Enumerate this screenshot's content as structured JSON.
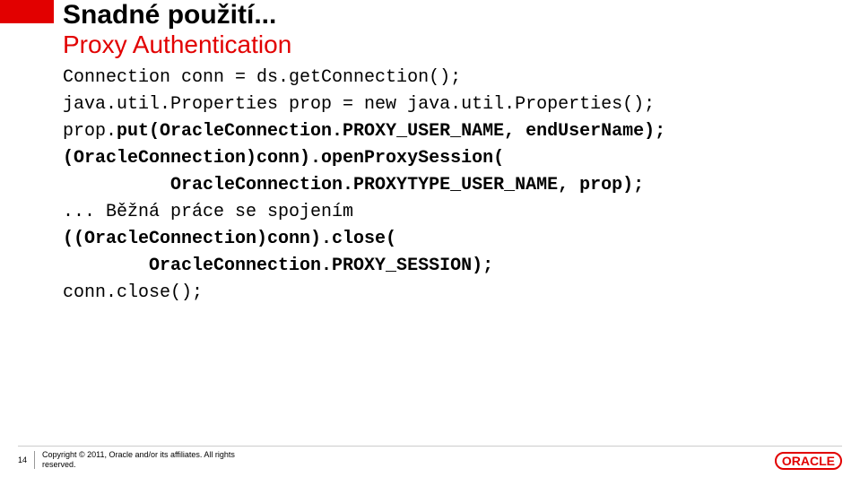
{
  "slide": {
    "title_main": "Snadné použití...",
    "title_sub": "Proxy Authentication",
    "code": {
      "line1": "Connection conn = ds.getConnection();",
      "line2": "",
      "line3": "java.util.Properties prop = new java.util.Properties();",
      "line4a": "prop.",
      "line4b": "put(OracleConnection.PROXY_USER_NAME, endUserName);",
      "line5": "(OracleConnection)conn).openProxySession(",
      "line6": "          OracleConnection.PROXYTYPE_USER_NAME, prop);",
      "line7": "",
      "line8": "... Běžná práce se spojením",
      "line9": "",
      "line10": "((OracleConnection)conn).close(",
      "line11": "        OracleConnection.PROXY_SESSION);",
      "line12": "conn.close();"
    }
  },
  "footer": {
    "page_num": "14",
    "copyright_line1": "Copyright © 2011, Oracle and/or its affiliates. All rights",
    "copyright_line2": "reserved."
  },
  "logo": {
    "text": "ORACLE"
  }
}
